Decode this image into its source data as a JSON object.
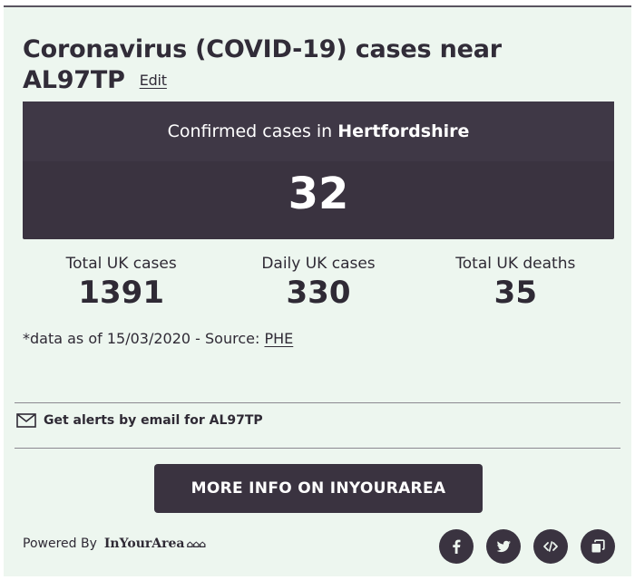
{
  "header": {
    "title_line1": "Coronavirus (COVID-19) cases near",
    "postcode": "AL97TP",
    "edit_label": "Edit"
  },
  "local": {
    "label_prefix": "Confirmed cases in",
    "area": "Hertfordshire",
    "count": "32"
  },
  "stats": [
    {
      "label": "Total UK cases",
      "value": "1391"
    },
    {
      "label": "Daily UK cases",
      "value": "330"
    },
    {
      "label": "Total UK deaths",
      "value": "35"
    }
  ],
  "source": {
    "text": "*data as of 15/03/2020 - Source:",
    "link": "PHE"
  },
  "alerts": {
    "icon": "mail-icon",
    "label": "Get alerts by email for AL97TP"
  },
  "cta": {
    "label": "MORE INFO ON INYOURAREA"
  },
  "footer": {
    "powered_label": "Powered By",
    "brand": "InYourArea",
    "social": [
      {
        "icon": "facebook-icon"
      },
      {
        "icon": "twitter-icon"
      },
      {
        "icon": "embed-code-icon"
      },
      {
        "icon": "copy-icon"
      }
    ]
  },
  "colors": {
    "panel_bg": "#edf6ef",
    "dark": "#3a3340",
    "text": "#2f2a35"
  }
}
